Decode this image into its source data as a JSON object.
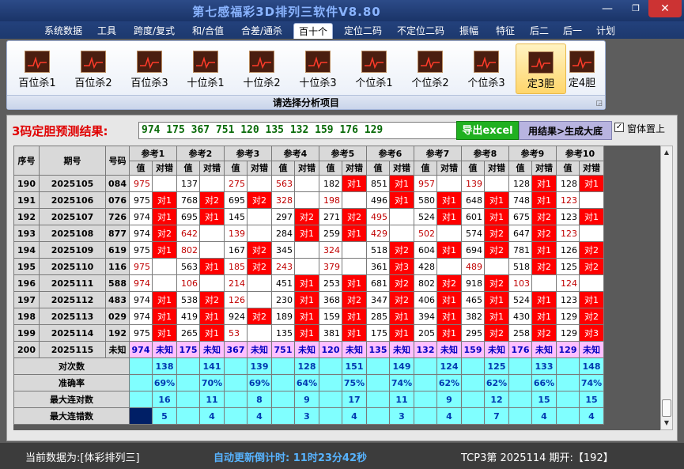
{
  "window": {
    "title": "第七感福彩3D排列三软件V8.80",
    "minimize": "—",
    "maximize": "❐",
    "close": "✕"
  },
  "menu": [
    {
      "label": "系统数据"
    },
    {
      "label": "工具"
    },
    {
      "label": "跨度/复式"
    },
    {
      "label": "和/合值"
    },
    {
      "label": "合差/通杀"
    },
    {
      "label": "百十个",
      "active": true
    },
    {
      "label": "定位二码"
    },
    {
      "label": "不定位二码"
    },
    {
      "label": "振幅"
    },
    {
      "label": "特征"
    },
    {
      "label": "后二"
    },
    {
      "label": "后一"
    },
    {
      "label": "计划"
    }
  ],
  "ribbon": {
    "buttons": [
      {
        "label": "百位杀1"
      },
      {
        "label": "百位杀2"
      },
      {
        "label": "百位杀3"
      },
      {
        "label": "十位杀1"
      },
      {
        "label": "十位杀2"
      },
      {
        "label": "十位杀3"
      },
      {
        "label": "个位杀1"
      },
      {
        "label": "个位杀2"
      },
      {
        "label": "个位杀3"
      },
      {
        "label": "定3胆",
        "active": true
      },
      {
        "label": "定4胆"
      }
    ],
    "group_label": "请选择分析项目",
    "expand_glyph": "◲"
  },
  "prediction": {
    "label": "3码定胆预测结果:",
    "value": "974 175 367 751 120 135 132 159 176 129",
    "export_label": "导出excel",
    "generate_label": "用结果>生成大底",
    "topmost_label": "窗体置上",
    "topmost_checked": "✓"
  },
  "table": {
    "headers": {
      "seq": "序号",
      "period": "期号",
      "number": "号码",
      "value": "值",
      "mark": "对错"
    },
    "ref_labels": [
      "参考1",
      "参考2",
      "参考3",
      "参考4",
      "参考5",
      "参考6",
      "参考7",
      "参考8",
      "参考9",
      "参考10"
    ],
    "rows": [
      {
        "seq": "190",
        "period": "2025105",
        "num": "084",
        "v": [
          "975",
          "137",
          "275",
          "563",
          "182",
          "851",
          "957",
          "139",
          "128",
          "128"
        ],
        "m": [
          "",
          "",
          "",
          "",
          "对1",
          "对1",
          "",
          "",
          "对1",
          "对1"
        ]
      },
      {
        "seq": "191",
        "period": "2025106",
        "num": "076",
        "v": [
          "975",
          "768",
          "695",
          "328",
          "198",
          "496",
          "580",
          "648",
          "748",
          "123"
        ],
        "m": [
          "对1",
          "对2",
          "对2",
          "",
          "",
          "对1",
          "对1",
          "对1",
          "对1",
          ""
        ]
      },
      {
        "seq": "192",
        "period": "2025107",
        "num": "726",
        "v": [
          "974",
          "695",
          "145",
          "297",
          "271",
          "495",
          "524",
          "601",
          "675",
          "123"
        ],
        "m": [
          "对1",
          "对1",
          "",
          "对2",
          "对2",
          "",
          "对1",
          "对1",
          "对2",
          "对1"
        ]
      },
      {
        "seq": "193",
        "period": "2025108",
        "num": "877",
        "v": [
          "974",
          "642",
          "139",
          "284",
          "259",
          "429",
          "502",
          "574",
          "647",
          "123"
        ],
        "m": [
          "对2",
          "",
          "",
          "对1",
          "对1",
          "",
          "",
          "对2",
          "对2",
          ""
        ]
      },
      {
        "seq": "194",
        "period": "2025109",
        "num": "619",
        "v": [
          "975",
          "802",
          "167",
          "345",
          "324",
          "518",
          "604",
          "694",
          "781",
          "126"
        ],
        "m": [
          "对1",
          "",
          "对2",
          "",
          "",
          "对2",
          "对1",
          "对2",
          "对1",
          "对2"
        ]
      },
      {
        "seq": "195",
        "period": "2025110",
        "num": "116",
        "v": [
          "975",
          "563",
          "185",
          "243",
          "379",
          "361",
          "428",
          "489",
          "518",
          "125"
        ],
        "m": [
          "",
          "对1",
          "对2",
          "",
          "",
          "对3",
          "",
          "",
          "对2",
          "对2"
        ]
      },
      {
        "seq": "196",
        "period": "2025111",
        "num": "588",
        "v": [
          "974",
          "106",
          "214",
          "451",
          "253",
          "681",
          "802",
          "918",
          "103",
          "124"
        ],
        "m": [
          "",
          "",
          "",
          "对1",
          "对1",
          "对2",
          "对2",
          "对2",
          "",
          ""
        ]
      },
      {
        "seq": "197",
        "period": "2025112",
        "num": "483",
        "v": [
          "974",
          "538",
          "126",
          "230",
          "368",
          "347",
          "406",
          "465",
          "524",
          "123"
        ],
        "m": [
          "对1",
          "对2",
          "",
          "对1",
          "对2",
          "对2",
          "对1",
          "对1",
          "对1",
          "对1"
        ]
      },
      {
        "seq": "198",
        "period": "2025113",
        "num": "029",
        "v": [
          "974",
          "419",
          "924",
          "189",
          "159",
          "285",
          "394",
          "382",
          "430",
          "129"
        ],
        "m": [
          "对1",
          "对1",
          "对2",
          "对1",
          "对1",
          "对1",
          "对1",
          "对1",
          "对1",
          "对2"
        ]
      },
      {
        "seq": "199",
        "period": "2025114",
        "num": "192",
        "v": [
          "975",
          "265",
          "53",
          "135",
          "381",
          "175",
          "205",
          "295",
          "258",
          "129"
        ],
        "m": [
          "对1",
          "对1",
          "",
          "对1",
          "对1",
          "对1",
          "对1",
          "对2",
          "对2",
          "对3"
        ]
      },
      {
        "seq": "200",
        "period": "2025115",
        "num": "未知",
        "v": [
          "974",
          "175",
          "367",
          "751",
          "120",
          "135",
          "132",
          "159",
          "176",
          "129"
        ],
        "m": [
          "未知",
          "未知",
          "未知",
          "未知",
          "未知",
          "未知",
          "未知",
          "未知",
          "未知",
          "未知"
        ],
        "pending": true
      }
    ],
    "hot_values": [
      [
        1,
        0,
        1,
        1,
        0,
        0,
        1,
        1,
        0,
        0
      ],
      [
        0,
        0,
        0,
        1,
        1,
        0,
        0,
        0,
        0,
        1
      ],
      [
        0,
        0,
        0,
        0,
        0,
        1,
        0,
        0,
        0,
        0
      ],
      [
        0,
        1,
        1,
        0,
        0,
        1,
        1,
        0,
        0,
        1
      ],
      [
        0,
        1,
        0,
        0,
        1,
        0,
        0,
        0,
        0,
        0
      ],
      [
        1,
        0,
        1,
        1,
        1,
        0,
        0,
        1,
        0,
        0
      ],
      [
        1,
        1,
        1,
        0,
        0,
        0,
        0,
        0,
        1,
        1
      ],
      [
        0,
        0,
        1,
        0,
        0,
        0,
        0,
        0,
        0,
        0
      ],
      [
        0,
        0,
        0,
        0,
        0,
        0,
        0,
        0,
        0,
        0
      ],
      [
        0,
        0,
        1,
        0,
        0,
        0,
        0,
        0,
        0,
        0
      ],
      [
        0,
        0,
        0,
        0,
        0,
        0,
        0,
        0,
        0,
        0
      ]
    ],
    "stats": [
      {
        "label": "对次数",
        "values": [
          "138",
          "141",
          "139",
          "128",
          "151",
          "149",
          "124",
          "125",
          "133",
          "148"
        ]
      },
      {
        "label": "准确率",
        "values": [
          "69%",
          "70%",
          "69%",
          "64%",
          "75%",
          "74%",
          "62%",
          "62%",
          "66%",
          "74%"
        ]
      },
      {
        "label": "最大连对数",
        "values": [
          "16",
          "11",
          "8",
          "9",
          "17",
          "11",
          "9",
          "12",
          "15",
          "15"
        ]
      },
      {
        "label": "最大连错数",
        "values": [
          "5",
          "4",
          "4",
          "3",
          "4",
          "3",
          "4",
          "7",
          "4",
          "4"
        ]
      }
    ]
  },
  "scrollbar": {
    "up": "▲",
    "down": "▼"
  },
  "status": {
    "data_source": "当前数据为:[体彩排列三]",
    "countdown": "自动更新倒计时: 11时23分42秒",
    "period": "TCP3第 2025114 期开:【192】"
  }
}
